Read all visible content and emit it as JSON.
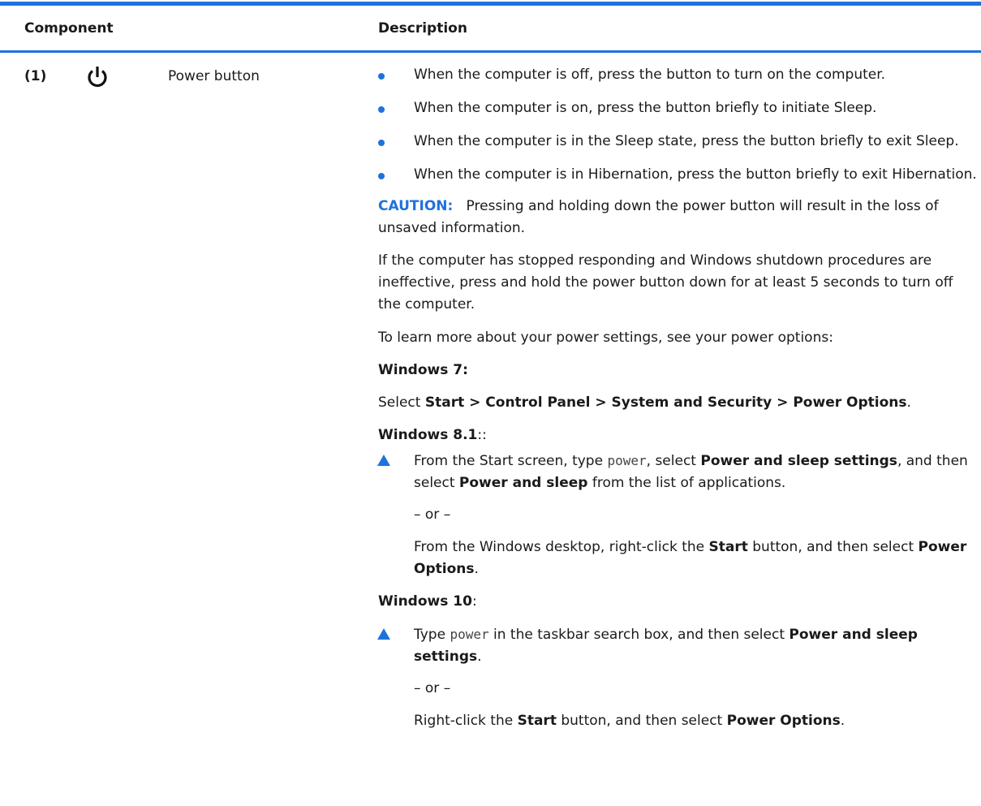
{
  "table": {
    "col_component": "Component",
    "col_description": "Description"
  },
  "row": {
    "number": "(1)",
    "icon": "power-icon",
    "name": "Power button"
  },
  "bullets": [
    "When the computer is off, press the button to turn on the computer.",
    "When the computer is on, press the button briefly to initiate Sleep.",
    "When the computer is in the Sleep state, press the button briefly to exit Sleep.",
    "When the computer is in Hibernation, press the button briefly to exit Hibernation."
  ],
  "caution": {
    "label": "CAUTION:",
    "text": "Pressing and holding down the power button will result in the loss of unsaved information."
  },
  "para_stopped": "If the computer has stopped responding and Windows shutdown procedures are ineffective, press and hold the power button down for at least 5 seconds to turn off the computer.",
  "para_learn": "To learn more about your power settings, see your power options:",
  "win7": {
    "heading": "Windows 7:",
    "select_prefix": "Select ",
    "path": "Start > Control Panel > System and Security > Power Options",
    "suffix": "."
  },
  "win81": {
    "heading": "Windows 8.1",
    "heading_suffix": "::",
    "step1_a": "From the Start screen, type ",
    "step1_code": "power",
    "step1_b": ", select ",
    "step1_bold1": "Power and sleep settings",
    "step1_c": ", and then select ",
    "step1_bold2": "Power and sleep",
    "step1_d": " from the list of applications.",
    "or": "– or –",
    "alt_a": "From the Windows desktop, right-click the ",
    "alt_bold1": "Start",
    "alt_b": " button, and then select ",
    "alt_bold2": "Power Options",
    "alt_c": "."
  },
  "win10": {
    "heading": "Windows 10",
    "heading_suffix": ":",
    "step1_a": "Type ",
    "step1_code": "power",
    "step1_b": " in the taskbar search box, and then select ",
    "step1_bold": "Power and sleep settings",
    "step1_c": ".",
    "or": "– or –",
    "alt_a": "Right-click the ",
    "alt_bold1": "Start",
    "alt_b": " button, and then select ",
    "alt_bold2": "Power Options",
    "alt_c": "."
  },
  "colors": {
    "accent": "#1f72db",
    "text": "#1a1a1a"
  }
}
